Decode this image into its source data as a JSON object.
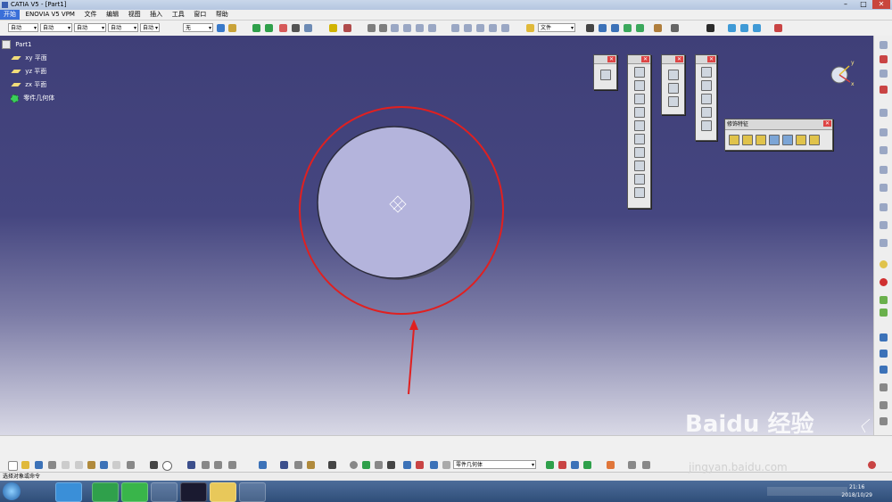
{
  "window": {
    "title": "CATIA V5 - [Part1]"
  },
  "menu": [
    "开始",
    "ENOVIA V5 VPM",
    "文件",
    "编辑",
    "视图",
    "插入",
    "工具",
    "窗口",
    "帮助"
  ],
  "toolbar": {
    "combos": [
      "自动",
      "自动",
      "自动",
      "自动",
      "自动",
      "无"
    ],
    "file_combo": "文件"
  },
  "tree": {
    "root": "Part1",
    "items": [
      "xy 平面",
      "yz 平面",
      "zx 平面",
      "零件几何体"
    ]
  },
  "palettes": {
    "feature_title": "修饰特征"
  },
  "bottom": {
    "body_combo": "零件几何体"
  },
  "status": "选择对象或命令",
  "clock": {
    "time": "21:16",
    "date": "2018/10/29"
  },
  "watermark": {
    "brand": "Baidu 经验",
    "url": "jingyan.baidu.com"
  },
  "colors": {
    "viewport_top": "#3f3f78",
    "highlight_circle": "#e02020",
    "disc": "#b4b4dc"
  }
}
